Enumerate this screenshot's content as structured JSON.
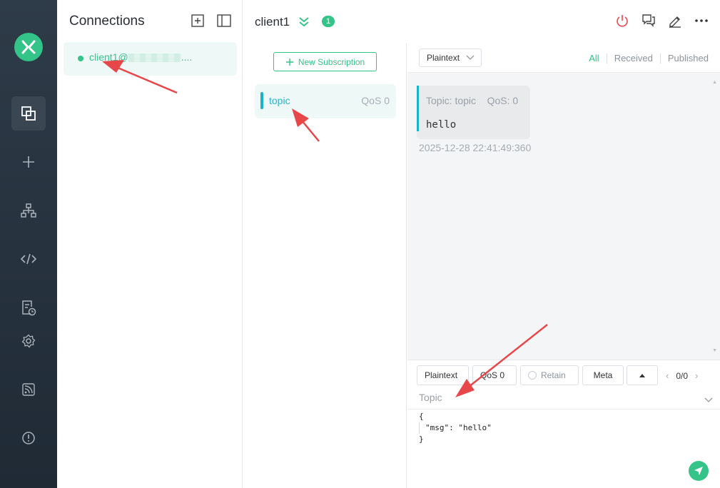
{
  "sidebar": {
    "logo_icon": "mqttx-logo",
    "items": [
      {
        "icon": "connections-icon",
        "active": true
      },
      {
        "icon": "plus-icon"
      },
      {
        "icon": "topology-icon"
      },
      {
        "icon": "script-icon"
      },
      {
        "icon": "log-icon"
      },
      {
        "icon": "gear-icon"
      },
      {
        "icon": "feed-icon"
      },
      {
        "icon": "info-icon"
      }
    ]
  },
  "connections": {
    "title": "Connections",
    "items": [
      {
        "name": "client1@",
        "suffix": "....",
        "status": "connected"
      }
    ]
  },
  "header": {
    "title": "client1",
    "badge": "1"
  },
  "subscriptions": {
    "new_label": "New Subscription",
    "items": [
      {
        "topic": "topic",
        "qos": "QoS 0"
      }
    ]
  },
  "messages": {
    "format": "Plaintext",
    "filters": [
      "All",
      "Received",
      "Published"
    ],
    "active_filter": "All",
    "items": [
      {
        "meta_topic": "Topic: topic",
        "meta_qos": "QoS: 0",
        "payload": "hello",
        "time": "2025-12-28 22:41:49:360"
      }
    ]
  },
  "publish": {
    "format": "Plaintext",
    "qos": "QoS 0",
    "retain_label": "Retain",
    "meta_label": "Meta",
    "pager": "0/0",
    "topic_placeholder": "Topic",
    "payload_lines": [
      "{",
      "\"msg\": \"hello\"",
      "}"
    ]
  },
  "colors": {
    "accent": "#34c388",
    "topic_bar": "#1ab4c9",
    "rail_bg": "#2e3b48",
    "annotation": "#e8474a"
  }
}
